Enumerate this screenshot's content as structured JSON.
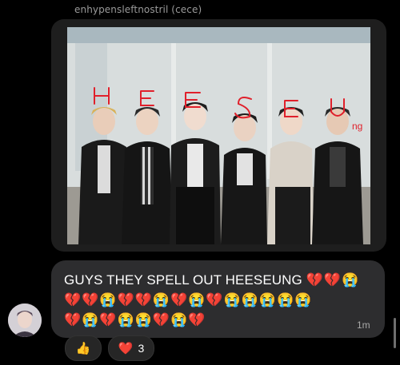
{
  "sender": "enhypensleftnostril (cece)",
  "message": {
    "text": "GUYS THEY SPELL OUT HEESEUNG",
    "emoji_line1": [
      "heart-broken",
      "heart-broken",
      "sob"
    ],
    "emoji_line2": [
      "heart-broken",
      "heart-broken",
      "sob",
      "heart-broken",
      "heart-broken",
      "sob",
      "heart-broken",
      "sob",
      "heart-broken",
      "sob",
      "sob",
      "sob",
      "sob",
      "sob"
    ],
    "emoji_line3": [
      "heart-broken",
      "sob",
      "heart-broken",
      "sob",
      "sob",
      "heart-broken",
      "sob",
      "heart-broken"
    ],
    "time": "1m"
  },
  "reactions": [
    {
      "emoji": "👍",
      "count": ""
    },
    {
      "emoji": "❤️",
      "count": "3"
    }
  ],
  "photo_annotation": "ng",
  "colors": {
    "bubble": "#2d2d2f",
    "annotation": "#e0202b",
    "background": "#000000"
  }
}
